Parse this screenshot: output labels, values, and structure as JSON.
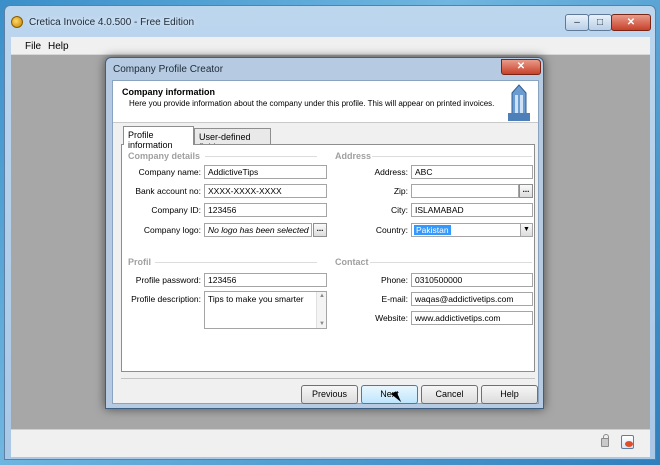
{
  "app": {
    "title": "Cretica Invoice 4.0.500 - Free Edition",
    "menu": {
      "file": "File",
      "help": "Help"
    },
    "win_buttons": {
      "minimize": "–",
      "maximize": "□",
      "close": "✕"
    }
  },
  "dialog": {
    "title": "Company Profile Creator",
    "close": "✕",
    "header": {
      "title": "Company information",
      "description": "Here you provide information about the company under this profile. This will appear on printed invoices."
    },
    "tabs": [
      {
        "label": "Profile information",
        "active": true
      },
      {
        "label": "User-defined fields",
        "active": false
      }
    ],
    "sections": {
      "company_details": "Company details",
      "address": "Address",
      "profil": "Profil",
      "contact": "Contact"
    },
    "fields": {
      "company_name": {
        "label": "Company name:",
        "value": "AddictiveTips"
      },
      "bank_account": {
        "label": "Bank account no:",
        "value": "XXXX-XXXX-XXXX"
      },
      "company_id": {
        "label": "Company ID:",
        "value": "123456"
      },
      "company_logo": {
        "label": "Company logo:",
        "value": "No logo has been selected",
        "browse": "..."
      },
      "address": {
        "label": "Address:",
        "value": "ABC"
      },
      "zip": {
        "label": "Zip:",
        "value": "",
        "browse": "..."
      },
      "city": {
        "label": "City:",
        "value": "ISLAMABAD"
      },
      "country": {
        "label": "Country:",
        "value": "Pakistan",
        "arrow": "▼"
      },
      "profile_password": {
        "label": "Profile password:",
        "value": "123456"
      },
      "profile_description": {
        "label": "Profile description:",
        "value": "Tips to make you smarter"
      },
      "phone": {
        "label": "Phone:",
        "value": "0310500000"
      },
      "email": {
        "label": "E-mail:",
        "value": "waqas@addictivetips.com"
      },
      "website": {
        "label": "Website:",
        "value": "www.addictivetips.com"
      }
    },
    "buttons": {
      "previous": "Previous",
      "next": "Next",
      "cancel": "Cancel",
      "help": "Help"
    }
  }
}
